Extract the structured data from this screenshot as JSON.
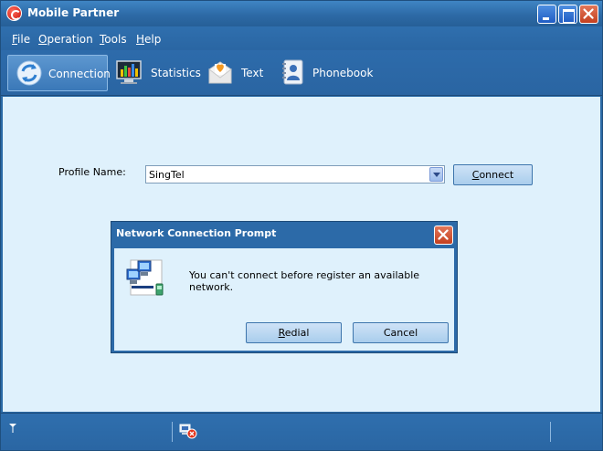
{
  "window": {
    "title": "Mobile Partner"
  },
  "menu": {
    "items": [
      {
        "accel": "F",
        "rest": "ile"
      },
      {
        "accel": "O",
        "rest": "peration"
      },
      {
        "accel": "T",
        "rest": "ools"
      },
      {
        "accel": "H",
        "rest": "elp"
      }
    ]
  },
  "toolbar": {
    "items": [
      {
        "label": "Connection",
        "icon": "connection-icon",
        "active": true
      },
      {
        "label": "Statistics",
        "icon": "statistics-icon",
        "active": false
      },
      {
        "label": "Text",
        "icon": "text-message-icon",
        "active": false
      },
      {
        "label": "Phonebook",
        "icon": "phonebook-icon",
        "active": false
      }
    ]
  },
  "profile": {
    "label": "Profile Name:",
    "value": "SingTel",
    "connect": {
      "accel": "C",
      "rest": "onnect"
    }
  },
  "dialog": {
    "title": "Network Connection Prompt",
    "message": "You can't connect before register an available network.",
    "redial": {
      "accel": "R",
      "rest": "edial"
    },
    "cancel_label": "Cancel",
    "icon": "network-computers-icon"
  },
  "colors": {
    "accent": "#2a66a3",
    "body": "#dff1fc"
  }
}
